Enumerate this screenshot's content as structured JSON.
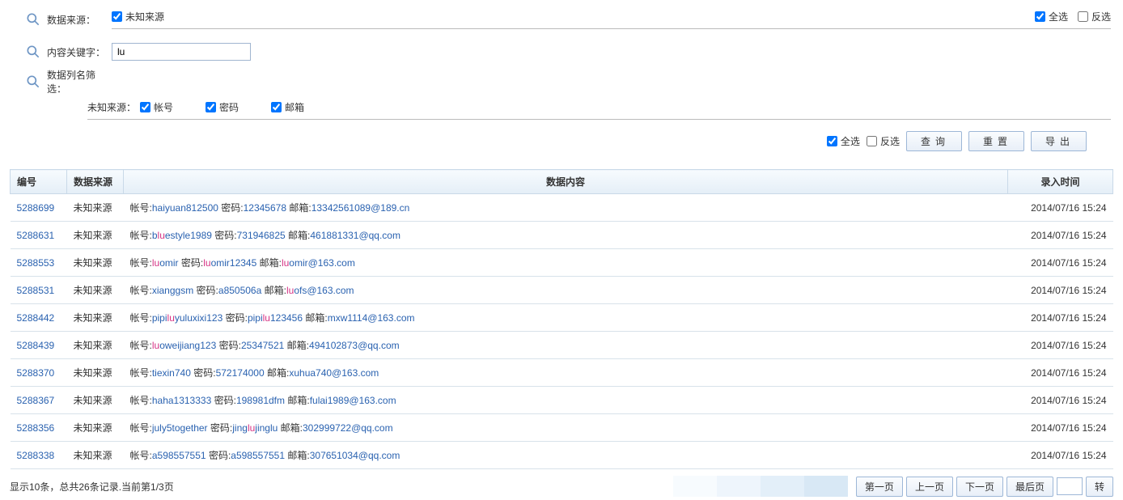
{
  "filters": {
    "data_source_label": "数据来源：",
    "unknown_source": "未知来源",
    "select_all": "全选",
    "invert_select": "反选",
    "keyword_label": "内容关键字：",
    "keyword_value": "lu",
    "column_filter_label": "数据列名筛选：",
    "source_prefix": "未知来源：",
    "col_account": "帐号",
    "col_password": "密码",
    "col_email": "邮箱"
  },
  "actions": {
    "select_all": "全选",
    "invert_select": "反选",
    "query": "查询",
    "reset": "重置",
    "export": "导出"
  },
  "table": {
    "headers": {
      "id": "编号",
      "source": "数据来源",
      "content": "数据内容",
      "time": "录入时间"
    },
    "lbl_account": "帐号:",
    "lbl_password": "密码:",
    "lbl_email": "邮箱:",
    "rows": [
      {
        "id": "5288699",
        "source": "未知来源",
        "account_pre": "haiyuan812500",
        "account_hl": "",
        "account_post": "",
        "pwd_pre": "12345678",
        "pwd_hl": "",
        "pwd_post": "",
        "email_pre": "13342561089@189.cn",
        "email_hl": "",
        "email_post": "",
        "time": "2014/07/16 15:24"
      },
      {
        "id": "5288631",
        "source": "未知来源",
        "account_pre": "b",
        "account_hl": "lu",
        "account_post": "estyle1989",
        "pwd_pre": "731946825",
        "pwd_hl": "",
        "pwd_post": "",
        "email_pre": "461881331@qq.com",
        "email_hl": "",
        "email_post": "",
        "time": "2014/07/16 15:24"
      },
      {
        "id": "5288553",
        "source": "未知来源",
        "account_pre": "",
        "account_hl": "lu",
        "account_post": "omir",
        "pwd_pre": "",
        "pwd_hl": "lu",
        "pwd_post": "omir12345",
        "email_pre": "",
        "email_hl": "lu",
        "email_post": "omir@163.com",
        "time": "2014/07/16 15:24"
      },
      {
        "id": "5288531",
        "source": "未知来源",
        "account_pre": "xianggsm",
        "account_hl": "",
        "account_post": "",
        "pwd_pre": "a850506a",
        "pwd_hl": "",
        "pwd_post": "",
        "email_pre": "",
        "email_hl": "lu",
        "email_post": "ofs@163.com",
        "time": "2014/07/16 15:24"
      },
      {
        "id": "5288442",
        "source": "未知来源",
        "account_pre": "pipi",
        "account_hl": "lu",
        "account_post": "yuluxixi123",
        "pwd_pre": "pipi",
        "pwd_hl": "lu",
        "pwd_post": "123456",
        "email_pre": "mxw1114@163.com",
        "email_hl": "",
        "email_post": "",
        "time": "2014/07/16 15:24"
      },
      {
        "id": "5288439",
        "source": "未知来源",
        "account_pre": "",
        "account_hl": "lu",
        "account_post": "oweijiang123",
        "pwd_pre": "25347521",
        "pwd_hl": "",
        "pwd_post": "",
        "email_pre": "494102873@qq.com",
        "email_hl": "",
        "email_post": "",
        "time": "2014/07/16 15:24"
      },
      {
        "id": "5288370",
        "source": "未知来源",
        "account_pre": "tiexin740",
        "account_hl": "",
        "account_post": "",
        "pwd_pre": "572174000",
        "pwd_hl": "",
        "pwd_post": "",
        "email_pre": "xuhua740@163.com",
        "email_hl": "",
        "email_post": "",
        "time": "2014/07/16 15:24"
      },
      {
        "id": "5288367",
        "source": "未知来源",
        "account_pre": "haha1313333",
        "account_hl": "",
        "account_post": "",
        "pwd_pre": "198981dfm",
        "pwd_hl": "",
        "pwd_post": "",
        "email_pre": "fulai1989@163.com",
        "email_hl": "",
        "email_post": "",
        "time": "2014/07/16 15:24"
      },
      {
        "id": "5288356",
        "source": "未知来源",
        "account_pre": "july5together",
        "account_hl": "",
        "account_post": "",
        "pwd_pre": "jing",
        "pwd_hl": "lu",
        "pwd_post": "jinglu",
        "email_pre": "302999722@qq.com",
        "email_hl": "",
        "email_post": "",
        "time": "2014/07/16 15:24"
      },
      {
        "id": "5288338",
        "source": "未知来源",
        "account_pre": "a598557551",
        "account_hl": "",
        "account_post": "",
        "pwd_pre": "a598557551",
        "pwd_hl": "",
        "pwd_post": "",
        "email_pre": "307651034@qq.com",
        "email_hl": "",
        "email_post": "",
        "time": "2014/07/16 15:24"
      }
    ]
  },
  "footer": {
    "info": "显示10条，总共26条记录.当前第1/3页",
    "first": "第一页",
    "prev": "上一页",
    "next": "下一页",
    "last": "最后页",
    "go": "转"
  }
}
